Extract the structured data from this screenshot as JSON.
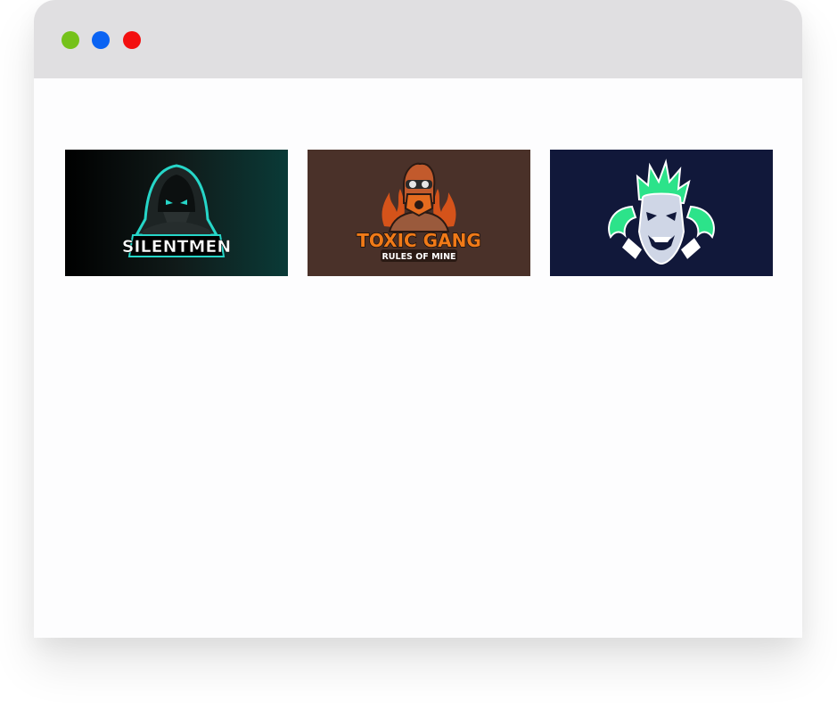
{
  "window": {
    "controls": [
      {
        "name": "green",
        "color": "#75c21b"
      },
      {
        "name": "blue",
        "color": "#0a63f3"
      },
      {
        "name": "red",
        "color": "#f30f0f"
      }
    ]
  },
  "gallery": {
    "items": [
      {
        "title": "SILENTMEN",
        "background": "#0b1312",
        "accent": "#26d6c8"
      },
      {
        "title": "TOXIC GANG",
        "subtitle": "RULES OF MINE",
        "background": "#4a3129",
        "accent": "#f07a18"
      },
      {
        "title": "",
        "background": "#11183a",
        "accent": "#2ce38a"
      }
    ]
  }
}
